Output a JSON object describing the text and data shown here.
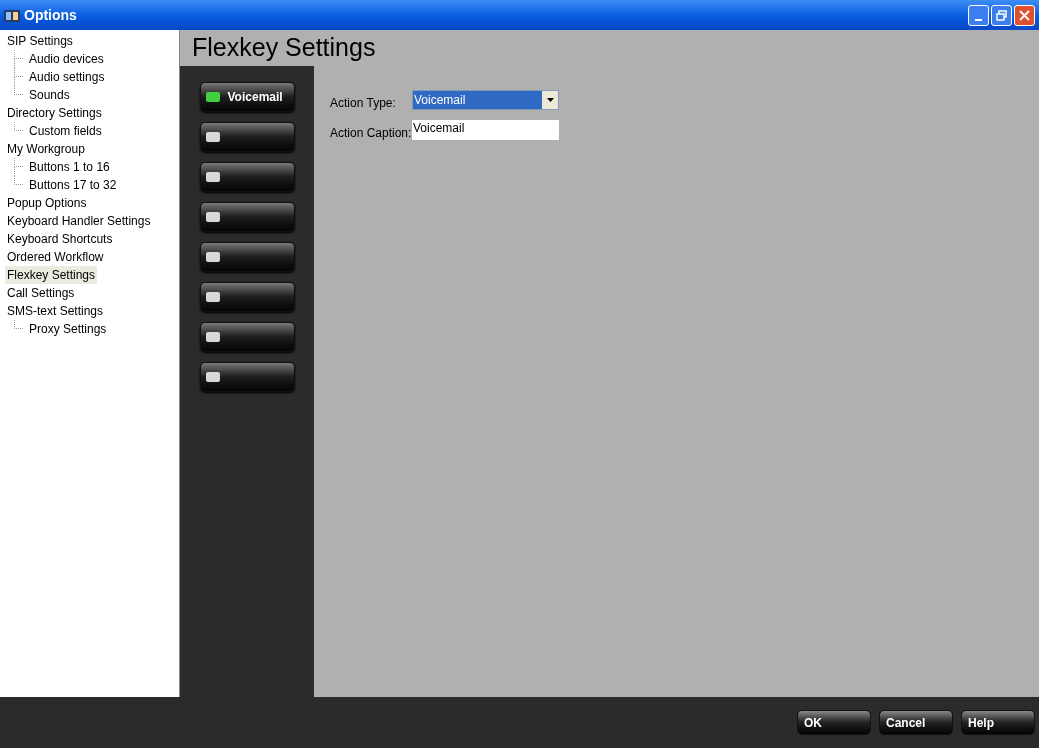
{
  "window": {
    "title": "Options"
  },
  "tree": [
    {
      "label": "SIP Settings",
      "selected": false,
      "children": [
        {
          "label": "Audio devices",
          "selected": false
        },
        {
          "label": "Audio settings",
          "selected": false
        },
        {
          "label": "Sounds",
          "selected": false
        }
      ]
    },
    {
      "label": "Directory Settings",
      "selected": false,
      "children": [
        {
          "label": "Custom fields",
          "selected": false
        }
      ]
    },
    {
      "label": "My Workgroup",
      "selected": false,
      "children": [
        {
          "label": "Buttons 1 to 16",
          "selected": false
        },
        {
          "label": "Buttons 17 to 32",
          "selected": false
        }
      ]
    },
    {
      "label": "Popup Options",
      "selected": false
    },
    {
      "label": "Keyboard Handler Settings",
      "selected": false
    },
    {
      "label": "Keyboard Shortcuts",
      "selected": false
    },
    {
      "label": "Ordered Workflow",
      "selected": false
    },
    {
      "label": "Flexkey Settings",
      "selected": true
    },
    {
      "label": "Call Settings",
      "selected": false
    },
    {
      "label": "SMS-text Settings",
      "selected": false,
      "children": [
        {
          "label": "Proxy Settings",
          "selected": false
        }
      ]
    }
  ],
  "page_title": "Flexkey Settings",
  "flexkeys": [
    {
      "label": "Voicemail",
      "on": true
    },
    {
      "on": false
    },
    {
      "on": false
    },
    {
      "on": false
    },
    {
      "on": false
    },
    {
      "on": false
    },
    {
      "on": false
    },
    {
      "on": false
    }
  ],
  "form": {
    "action_type": {
      "label": "Action Type:",
      "value": "Voicemail"
    },
    "action_caption": {
      "label": "Action Caption:",
      "value": "Voicemail"
    }
  },
  "buttons": [
    "OK",
    "Cancel",
    "Help"
  ]
}
